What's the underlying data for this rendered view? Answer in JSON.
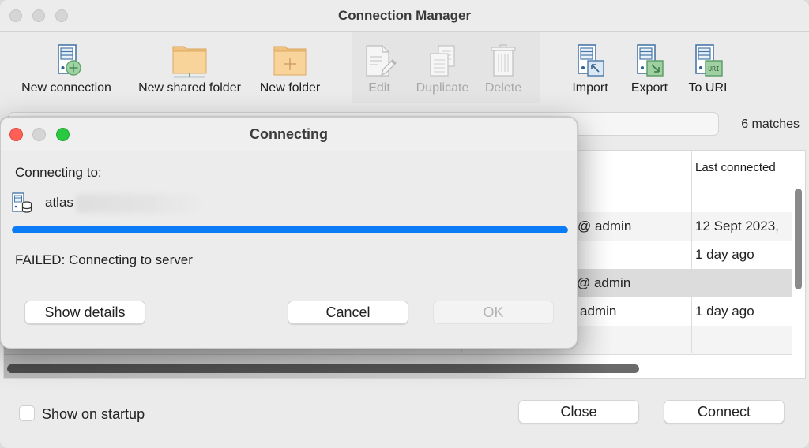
{
  "window": {
    "title": "Connection Manager"
  },
  "toolbar": {
    "items": [
      {
        "label": "New connection",
        "icon": "new-connection-icon",
        "enabled": true
      },
      {
        "label": "New shared folder",
        "icon": "shared-folder-icon",
        "enabled": true
      },
      {
        "label": "New folder",
        "icon": "new-folder-icon",
        "enabled": true
      },
      {
        "label": "Edit",
        "icon": "edit-icon",
        "enabled": false
      },
      {
        "label": "Duplicate",
        "icon": "duplicate-icon",
        "enabled": false
      },
      {
        "label": "Delete",
        "icon": "trash-icon",
        "enabled": false
      },
      {
        "label": "Import",
        "icon": "import-icon",
        "enabled": true
      },
      {
        "label": "Export",
        "icon": "export-icon",
        "enabled": true
      },
      {
        "label": "To URI",
        "icon": "to-uri-icon",
        "enabled": true
      }
    ],
    "uri_badge": "URI"
  },
  "search": {
    "value": "",
    "matches": "6 matches"
  },
  "table": {
    "columns": [
      "Last connected"
    ],
    "rows": [
      {
        "user": "",
        "last_connected": ""
      },
      {
        "user": "@ admin",
        "last_connected": "12 Sept 2023,"
      },
      {
        "user": "",
        "last_connected": "1 day ago"
      },
      {
        "user": "@ admin",
        "last_connected": "",
        "selected": true
      },
      {
        "user": "admin",
        "last_connected": "1 day ago"
      },
      {
        "user": "",
        "last_connected": ""
      }
    ]
  },
  "footer": {
    "show_on_startup_label": "Show on startup",
    "show_on_startup_checked": false,
    "close_label": "Close",
    "connect_label": "Connect"
  },
  "dialog": {
    "title": "Connecting",
    "connecting_to_label": "Connecting to:",
    "host": "atlas",
    "progress": 1.0,
    "status": "FAILED: Connecting to server",
    "show_details_label": "Show details",
    "cancel_label": "Cancel",
    "ok_label": "OK",
    "ok_enabled": false
  },
  "colors": {
    "accent": "#0a7cf5",
    "close_light": "#fe5f57",
    "minimize_light": "#d5d5d5",
    "zoom_light": "#28c840"
  }
}
